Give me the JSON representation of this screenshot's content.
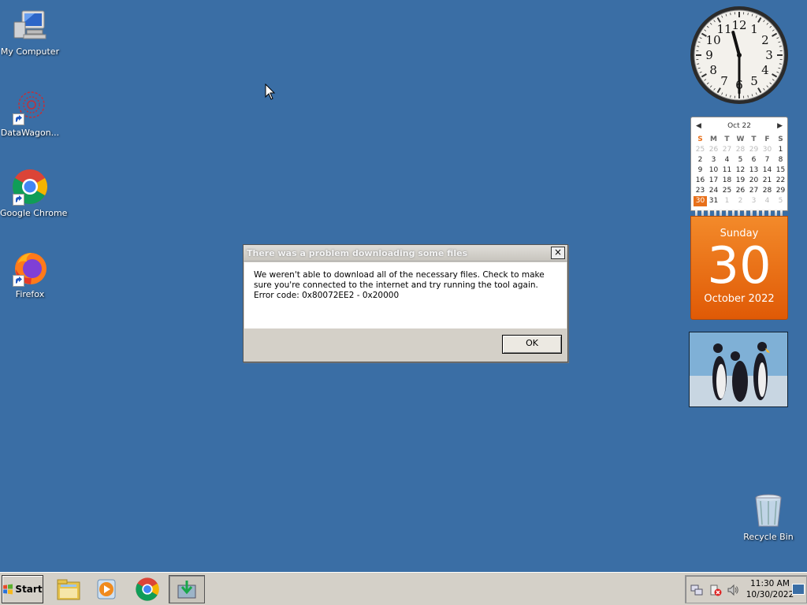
{
  "desktop": {
    "icons": [
      {
        "label": "My Computer",
        "icon": "computer-icon"
      },
      {
        "label": "DataWagon...",
        "icon": "datawagon-icon"
      },
      {
        "label": "Google Chrome",
        "icon": "chrome-icon"
      },
      {
        "label": "Firefox",
        "icon": "firefox-icon"
      }
    ],
    "recycle_bin": {
      "label": "Recycle Bin",
      "icon": "recycle-bin-icon"
    }
  },
  "calendar": {
    "month_label": "Oct 22",
    "weekdays": [
      "S",
      "M",
      "T",
      "W",
      "T",
      "F",
      "S"
    ],
    "weeks": [
      [
        "25",
        "26",
        "27",
        "28",
        "29",
        "30",
        "1"
      ],
      [
        "2",
        "3",
        "4",
        "5",
        "6",
        "7",
        "8"
      ],
      [
        "9",
        "10",
        "11",
        "12",
        "13",
        "14",
        "15"
      ],
      [
        "16",
        "17",
        "18",
        "19",
        "20",
        "21",
        "22"
      ],
      [
        "23",
        "24",
        "25",
        "26",
        "27",
        "28",
        "29"
      ],
      [
        "30",
        "31",
        "1",
        "2",
        "3",
        "4",
        "5"
      ]
    ],
    "today_weekday": "Sunday",
    "today_day": "30",
    "today_month_year": "October 2022"
  },
  "clock": {
    "hour": 11,
    "minute": 30
  },
  "dialog": {
    "title": "There was a problem downloading some files",
    "message": "We weren't able to download all of the necessary files. Check to make sure you're connected to the internet and try running the tool again. Error code: 0x80072EE2 - 0x20000",
    "ok_label": "OK",
    "close_label": "×"
  },
  "taskbar": {
    "start_label": "Start",
    "pinned": [
      "file-explorer-icon",
      "media-player-icon",
      "chrome-icon",
      "installer-icon"
    ],
    "tray": {
      "time": "11:30 AM",
      "date": "10/30/2022"
    }
  },
  "colors": {
    "desktop": "#3a6ea5",
    "calendar_accent": "#e8701a"
  }
}
